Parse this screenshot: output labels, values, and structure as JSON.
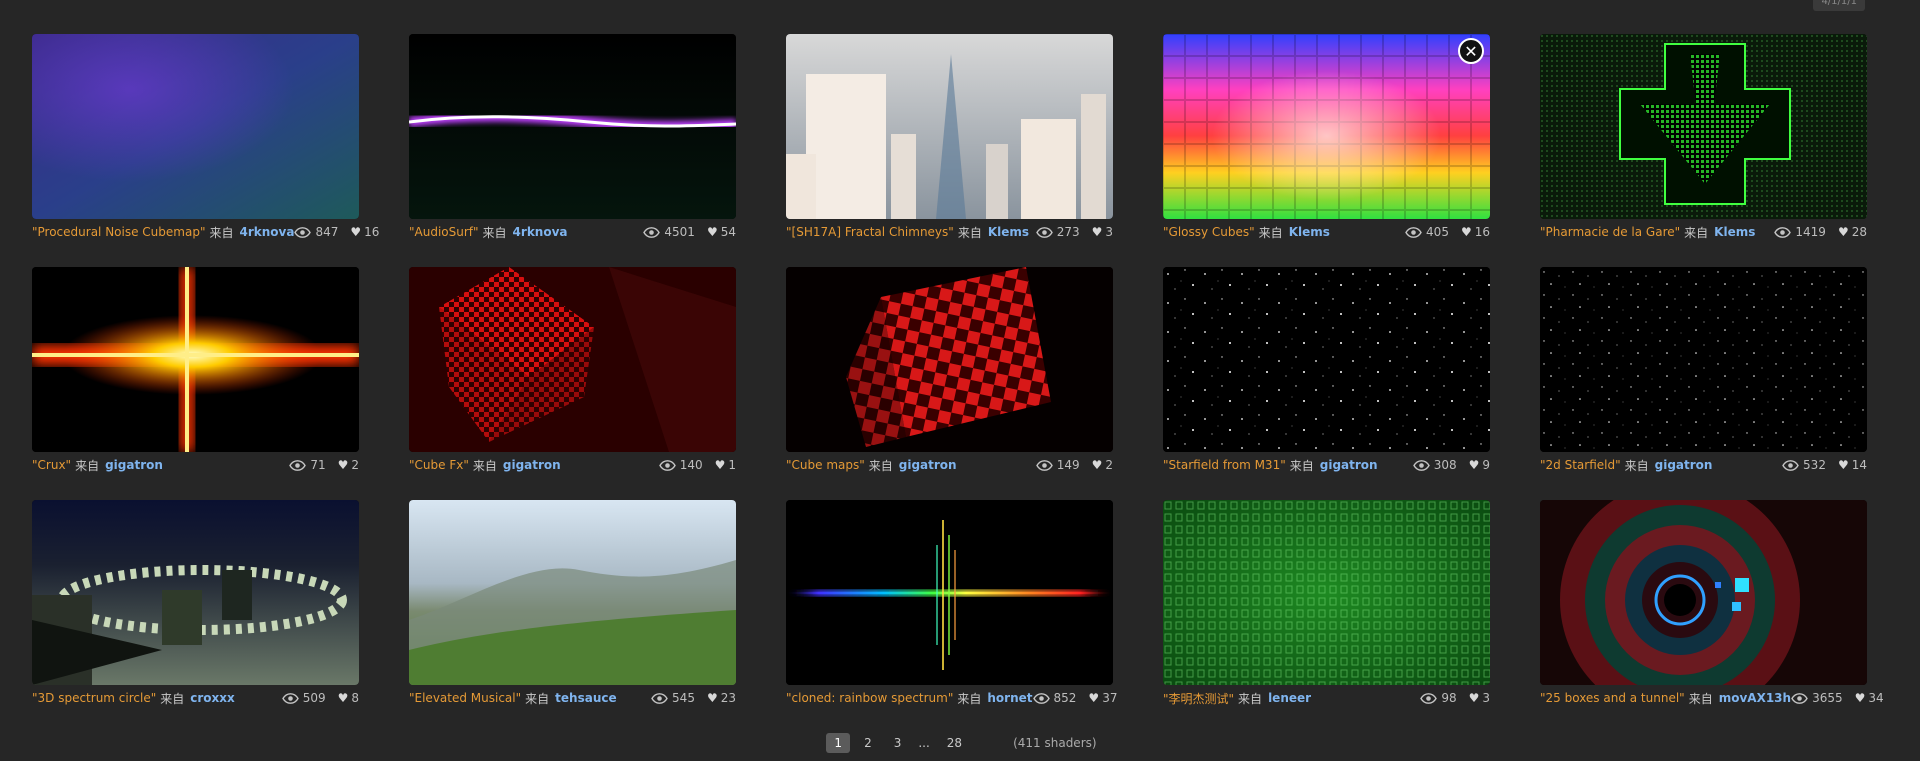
{
  "top_badge": "4/1/1/1",
  "cards": [
    {
      "title": "\"Procedural Noise Cubemap\"",
      "from": "来自",
      "author": "4rknova",
      "views": "847",
      "likes": "16"
    },
    {
      "title": "\"AudioSurf\"",
      "from": "来自",
      "author": "4rknova",
      "views": "4501",
      "likes": "54"
    },
    {
      "title": "\"[SH17A] Fractal Chimneys\"",
      "from": "来自",
      "author": "Klems",
      "views": "273",
      "likes": "3"
    },
    {
      "title": "\"Glossy Cubes\"",
      "from": "来自",
      "author": "Klems",
      "views": "405",
      "likes": "16"
    },
    {
      "title": "\"Pharmacie de la Gare\"",
      "from": "来自",
      "author": "Klems",
      "views": "1419",
      "likes": "28"
    },
    {
      "title": "\"Crux\"",
      "from": "来自",
      "author": "gigatron",
      "views": "71",
      "likes": "2"
    },
    {
      "title": "\"Cube Fx\"",
      "from": "来自",
      "author": "gigatron",
      "views": "140",
      "likes": "1"
    },
    {
      "title": "\"Cube maps\"",
      "from": "来自",
      "author": "gigatron",
      "views": "149",
      "likes": "2"
    },
    {
      "title": "\"Starfield from M31\"",
      "from": "来自",
      "author": "gigatron",
      "views": "308",
      "likes": "9"
    },
    {
      "title": "\"2d Starfield\"",
      "from": "来自",
      "author": "gigatron",
      "views": "532",
      "likes": "14"
    },
    {
      "title": "\"3D spectrum circle\"",
      "from": "来自",
      "author": "croxxx",
      "views": "509",
      "likes": "8"
    },
    {
      "title": "\"Elevated Musical\"",
      "from": "来自",
      "author": "tehsauce",
      "views": "545",
      "likes": "23"
    },
    {
      "title": "\"cloned: rainbow spectrum\"",
      "from": "来自",
      "author": "hornet",
      "views": "852",
      "likes": "37"
    },
    {
      "title": "\"李明杰测试\"",
      "from": "来自",
      "author": "leneer",
      "views": "98",
      "likes": "3"
    },
    {
      "title": "\"25 boxes and a tunnel\"",
      "from": "来自",
      "author": "movAX13h",
      "views": "3655",
      "likes": "34"
    }
  ],
  "close_label": "✕",
  "pagination": {
    "pages": [
      "1",
      "2",
      "3"
    ],
    "ellipsis": "...",
    "last": "28",
    "active_index": 0,
    "total": "(411 shaders)"
  },
  "colors": {
    "title": "#e59a36",
    "author": "#7fb4ee",
    "background": "#262626"
  }
}
